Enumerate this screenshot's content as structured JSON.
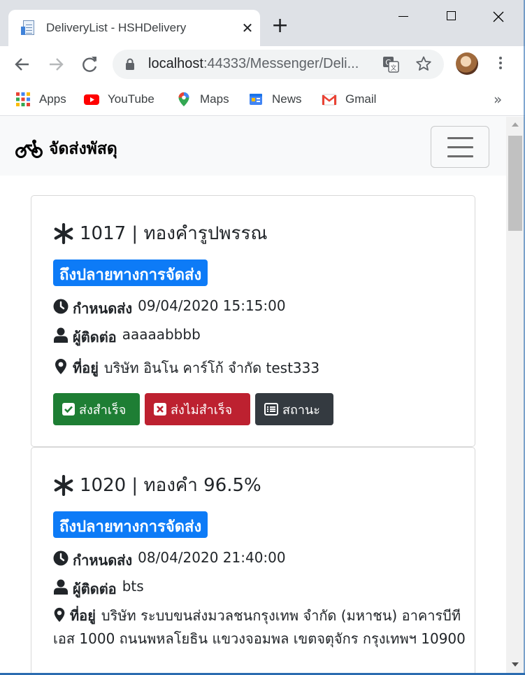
{
  "browser": {
    "tab_title": "DeliveryList - HSHDelivery",
    "url_host": "localhost",
    "url_rest": ":44333/Messenger/Deli...",
    "bookmarks": [
      "Apps",
      "YouTube",
      "Maps",
      "News",
      "Gmail"
    ],
    "bookmarks_more": "»"
  },
  "navbar": {
    "brand": "จัดส่งพัสดุ"
  },
  "deliveries": [
    {
      "title": "1017 | ทองคำรูปพรรณ",
      "status": "ถึงปลายทางการจัดส่ง",
      "due_label": "กำหนดส่ง",
      "due_value": "09/04/2020 15:15:00",
      "contact_label": "ผู้ติดต่อ",
      "contact_value": "aaaaabbbb",
      "address_label": "ที่อยู่",
      "address_value": "บริษัท อินโน คาร์โก้ จำกัด test333",
      "buttons": {
        "success": "ส่งสำเร็จ",
        "fail": "ส่งไม่สำเร็จ",
        "status": "สถานะ"
      }
    },
    {
      "title": "1020 | ทองคำ 96.5%",
      "status": "ถึงปลายทางการจัดส่ง",
      "due_label": "กำหนดส่ง",
      "due_value": "08/04/2020 21:40:00",
      "contact_label": "ผู้ติดต่อ",
      "contact_value": "bts",
      "address_label": "ที่อยู่",
      "address_value": "บริษัท ระบบขนส่งมวลชนกรุงเทพ จำกัด (มหาชน) อาคารบีทีเอส 1000 ถนนพหลโยธิน แขวงจอมพล เขตจตุจักร กรุงเทพฯ 10900"
    }
  ],
  "colors": {
    "badge": "#0d7bf7",
    "success": "#1e7e34",
    "danger": "#bd2130",
    "dark": "#343a40"
  }
}
